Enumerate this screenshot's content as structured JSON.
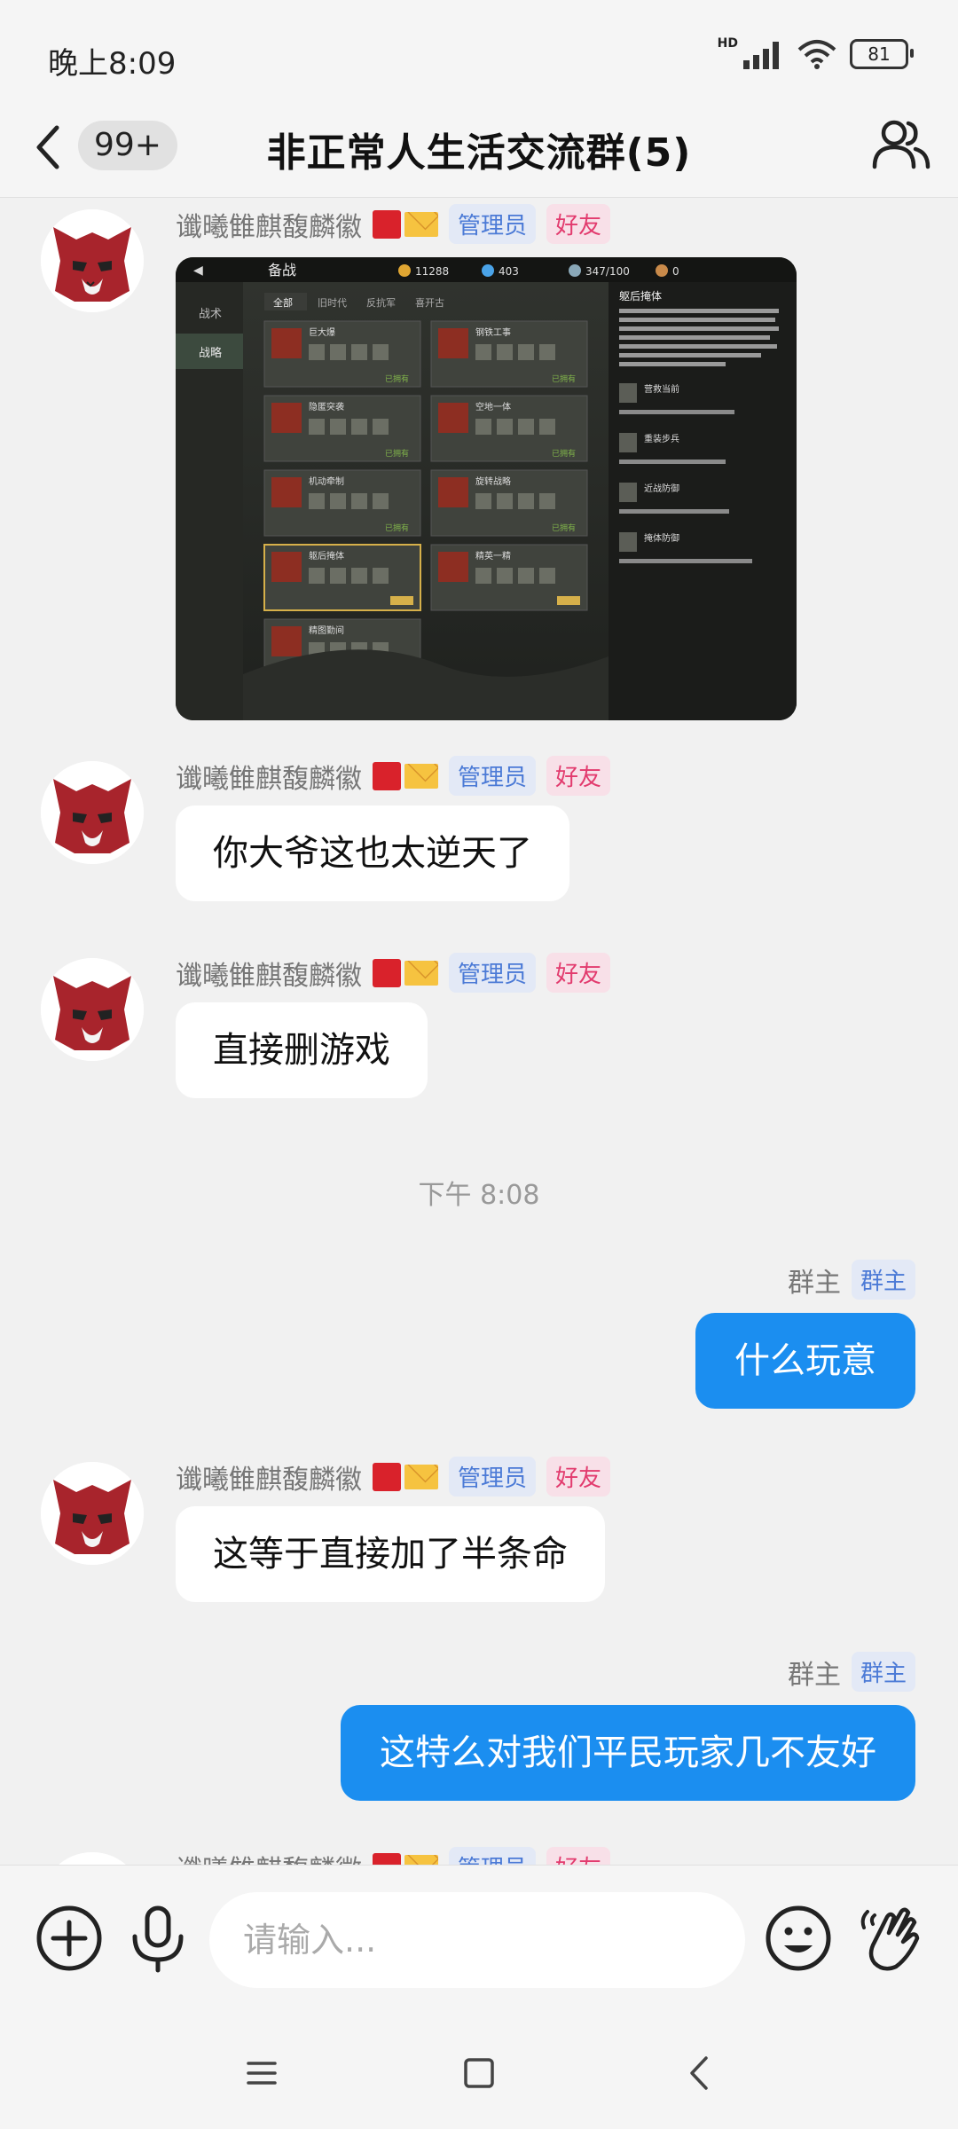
{
  "status_bar": {
    "time": "晚上8:09",
    "hd": "HD",
    "battery": "81"
  },
  "header": {
    "unread_count": "99+",
    "title": "非正常人生活交流群(5)"
  },
  "messages": [
    {
      "sender": "谶曦雔麒馥麟徽",
      "badges": [
        "管理员",
        "好友"
      ],
      "type": "image"
    },
    {
      "sender": "谶曦雔麒馥麟徽",
      "badges": [
        "管理员",
        "好友"
      ],
      "text": "你大爷这也太逆天了"
    },
    {
      "sender": "谶曦雔麒馥麟徽",
      "badges": [
        "管理员",
        "好友"
      ],
      "text": "直接删游戏"
    },
    {
      "timestamp": "下午 8:08"
    },
    {
      "sender": "群主",
      "badges": [
        "群主"
      ],
      "text": "什么玩意",
      "self": true
    },
    {
      "sender": "谶曦雔麒馥麟徽",
      "badges": [
        "管理员",
        "好友"
      ],
      "text": "这等于直接加了半条命"
    },
    {
      "sender": "群主",
      "badges": [
        "群主"
      ],
      "text": "这特么对我们平民玩家几不友好",
      "self": true
    },
    {
      "sender": "谶曦雔麒馥麟徽",
      "badges": [
        "管理员",
        "好友"
      ],
      "partial": true
    }
  ],
  "game_screenshot": {
    "title": "备战",
    "currency": [
      "11288",
      "403",
      "347/100",
      "0"
    ],
    "side_tabs": [
      "战术",
      "战略"
    ],
    "top_tabs": [
      "全部",
      "旧时代",
      "反抗军",
      "喜开古"
    ],
    "cards": [
      "巨大爆",
      "钢铁工事",
      "隐匿突袭",
      "空地一体",
      "机动牵制",
      "旋转战略",
      "躯后掩体",
      "精英一精",
      "精图勤间"
    ],
    "detail_title": "躯后掩体",
    "detail_lines": [
      "营救当前",
      "重装步兵",
      "近战防御",
      "掩体防御"
    ],
    "status_label": "已拥有"
  },
  "input": {
    "placeholder": "请输入..."
  },
  "icons": [
    "back-arrow-icon",
    "group-members-icon",
    "plus-icon",
    "microphone-icon",
    "emoji-icon",
    "poke-hand-icon",
    "menu-icon",
    "home-icon",
    "nav-back-icon"
  ]
}
